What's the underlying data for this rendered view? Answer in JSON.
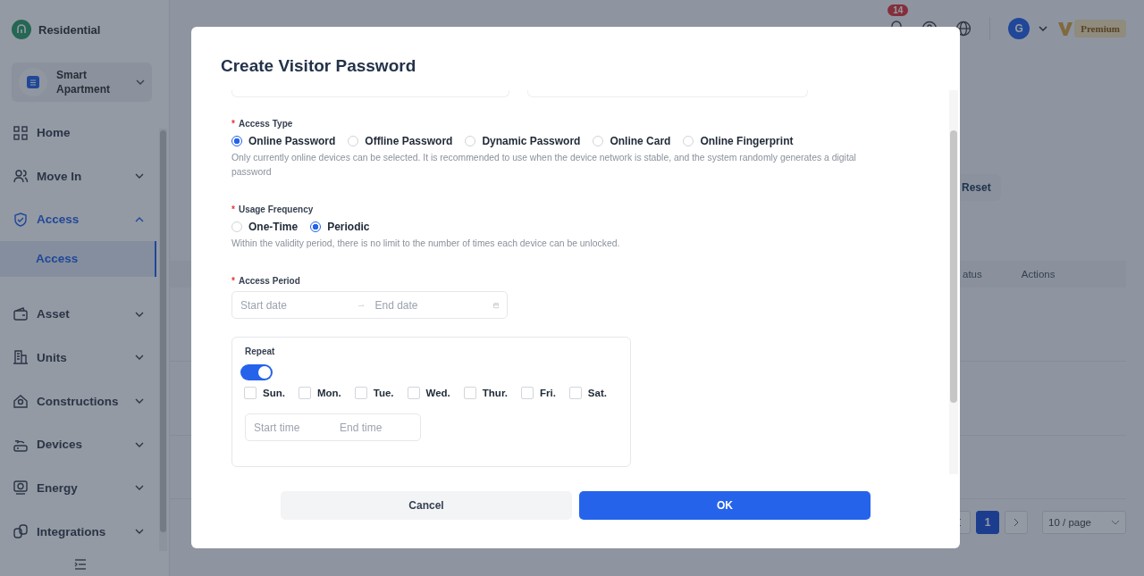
{
  "sidebar": {
    "brand": "Residential",
    "project": {
      "name": "Smart Apartment"
    },
    "items": [
      {
        "label": "Home",
        "selected": false
      },
      {
        "label": "Move In",
        "selected": false,
        "expanded": false
      },
      {
        "label": "Access",
        "selected": true,
        "expanded": true,
        "children": [
          {
            "label": "Access",
            "selected": true
          }
        ]
      },
      {
        "label": "Asset",
        "selected": false,
        "expanded": false
      },
      {
        "label": "Units",
        "selected": false,
        "expanded": false
      },
      {
        "label": "Constructions",
        "selected": false,
        "expanded": false
      },
      {
        "label": "Devices",
        "selected": false,
        "expanded": false
      },
      {
        "label": "Energy",
        "selected": false,
        "expanded": false
      },
      {
        "label": "Integrations",
        "selected": false,
        "expanded": false
      }
    ]
  },
  "header": {
    "notifications": "14",
    "avatar": "G",
    "plan": "Premium"
  },
  "page": {
    "reset_button": "Reset",
    "table": {
      "columns": [
        "atus",
        "Actions"
      ]
    },
    "pagination": {
      "pages": [
        {
          "label": "1",
          "selected": true
        }
      ],
      "page_size": "10 / page"
    }
  },
  "dialog": {
    "title": "Create Visitor Password",
    "access_type": {
      "mark": "*",
      "label": "Access Type",
      "options": [
        {
          "label": "Online Password",
          "selected": true
        },
        {
          "label": "Offline Password",
          "selected": false
        },
        {
          "label": "Dynamic Password",
          "selected": false
        },
        {
          "label": "Online Card",
          "selected": false
        },
        {
          "label": "Online Fingerprint",
          "selected": false
        }
      ],
      "hint": "Only currently online devices can be selected. It is recommended to use when the device network is stable, and the system randomly generates a digital password"
    },
    "usage_frequency": {
      "mark": "*",
      "label": "Usage Frequency",
      "options": [
        {
          "label": "One-Time",
          "selected": false
        },
        {
          "label": "Periodic",
          "selected": true
        }
      ],
      "hint": "Within the validity period, there is no limit to the number of times each device can be unlocked."
    },
    "access_period": {
      "mark": "*",
      "label": "Access Period",
      "start_placeholder": "Start date",
      "end_placeholder": "End date"
    },
    "repeat": {
      "label": "Repeat",
      "on": true,
      "days": [
        {
          "label": "Sun.",
          "checked": false
        },
        {
          "label": "Mon.",
          "checked": false
        },
        {
          "label": "Tue.",
          "checked": false
        },
        {
          "label": "Wed.",
          "checked": false
        },
        {
          "label": "Thur.",
          "checked": false
        },
        {
          "label": "Fri.",
          "checked": false
        },
        {
          "label": "Sat.",
          "checked": false
        }
      ],
      "start_placeholder": "Start time",
      "end_placeholder": "End time"
    },
    "buttons": {
      "cancel": "Cancel",
      "ok": "OK"
    }
  }
}
